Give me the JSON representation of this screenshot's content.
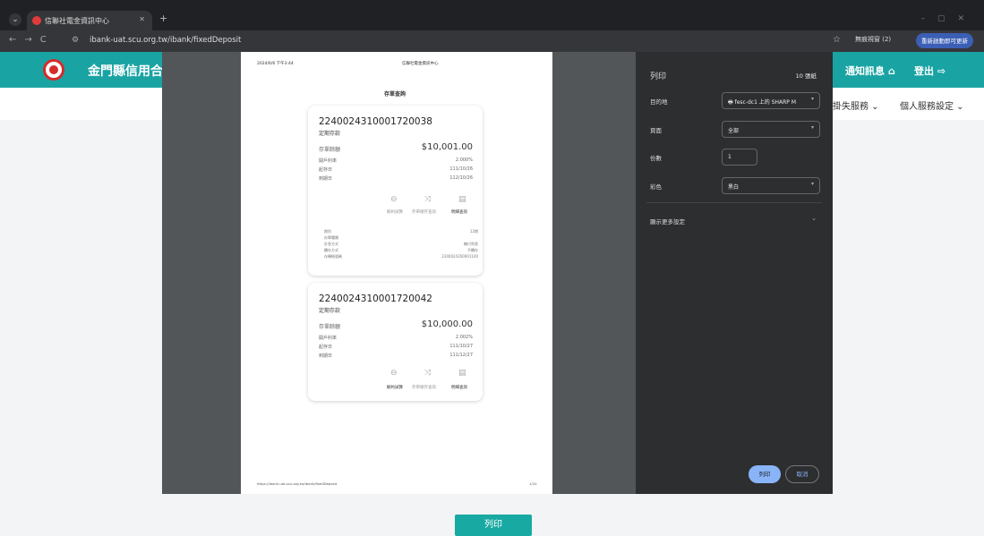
{
  "browser": {
    "tab_title": "信聯社電金資訊中心",
    "url": "ibank-uat.scu.org.tw/ibank/fixedDeposit",
    "profile": "無痕視窗 (2)",
    "update": "重新啟動即可更新"
  },
  "site": {
    "bank_name": "金門縣信用合",
    "notice": "通知訊息 ⌂",
    "logout": "登出 ⇨",
    "menu": [
      "掛失服務 ⌄",
      "個人服務設定 ⌄"
    ],
    "print_button": "列印"
  },
  "page": {
    "date": "2024/6/6 下午3:44",
    "header_title": "信聯社電金資訊中心",
    "heading": "存單查詢",
    "footer_url": "https://ibank-uat.scu.org.tw/ibank/fixedDeposit",
    "page_num": "1/10",
    "cards": [
      {
        "account": "2240024310001720038",
        "type": "定期存款",
        "amount_label": "存單餘額",
        "amount": "$10,001.00",
        "rows": [
          {
            "k": "開戶利率",
            "v": "2.000%"
          },
          {
            "k": "起存日",
            "v": "111/10/26"
          },
          {
            "k": "到期日",
            "v": "112/10/26"
          }
        ],
        "actions": [
          "解約試算",
          "存單總存查詢",
          "明細查詢"
        ],
        "details": [
          {
            "k": "期別",
            "v": "12期"
          },
          {
            "k": "存單種類",
            "v": ""
          },
          {
            "k": "計息方式",
            "v": "機付利息"
          },
          {
            "k": "續存方式",
            "v": "不續存"
          },
          {
            "k": "存轉帳號碼",
            "v": "2240024350001140"
          }
        ]
      },
      {
        "account": "2240024310001720042",
        "type": "定期存款",
        "amount_label": "存單餘額",
        "amount": "$10,000.00",
        "rows": [
          {
            "k": "開戶利率",
            "v": "2.002%"
          },
          {
            "k": "起存日",
            "v": "111/10/27"
          },
          {
            "k": "到期日",
            "v": "111/12/27"
          }
        ],
        "actions": [
          "解約試算",
          "存單總存查詢",
          "明細查詢"
        ]
      }
    ]
  },
  "print_settings": {
    "title": "列印",
    "pages": "10 張紙",
    "destination_label": "目的地",
    "destination": "fesc-dc1 上的 SHARP M",
    "pages_label": "頁面",
    "pages_value": "全部",
    "copies_label": "份數",
    "copies": "1",
    "color_label": "彩色",
    "color": "黑白",
    "more": "顯示更多設定",
    "print": "列印",
    "cancel": "取消"
  }
}
